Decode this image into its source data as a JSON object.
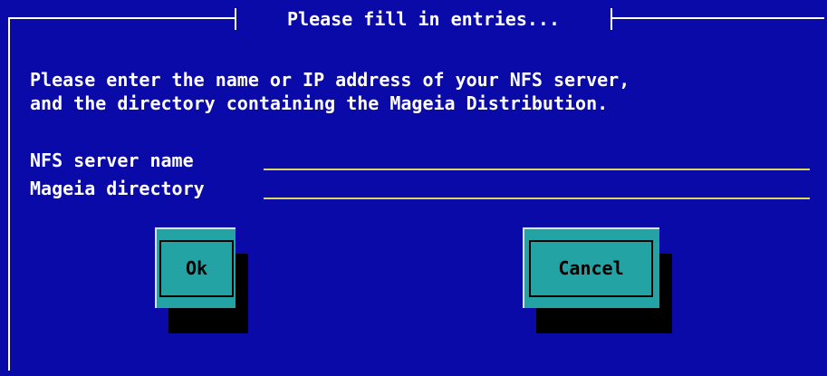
{
  "dialog": {
    "title": "Please fill in entries...",
    "message_line1": "Please enter the name or IP address of your NFS server,",
    "message_line2": "and the directory containing the Mageia Distribution.",
    "fields": [
      {
        "label": "NFS server name",
        "value": ""
      },
      {
        "label": "Mageia directory",
        "value": ""
      }
    ],
    "buttons": {
      "ok": "Ok",
      "cancel": "Cancel"
    }
  },
  "colors": {
    "dialog_background": "#0a0aa8",
    "button_face": "#23a3a3",
    "field_underline": "#d8d860",
    "text": "#ffffff"
  }
}
